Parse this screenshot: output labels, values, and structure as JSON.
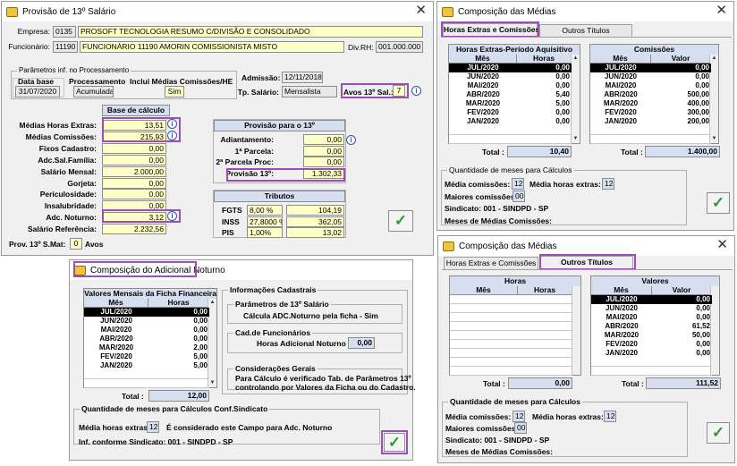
{
  "win1": {
    "title": "Provisão de 13º Salário",
    "empresa_label": "Empresa:",
    "empresa_code": "0135",
    "empresa_name": "PROSOFT TECNOLOGIA RESUMO C/DIVISÃO E CONSOLIDADO",
    "funcionario_label": "Funcionário:",
    "funcionario_code": "11190",
    "funcionario_name": "FUNCIONÁRIO 11190 AMORIN COMISSIONISTA MISTO",
    "divrh_label": "Div.RH:",
    "divrh_value": "001.000.000",
    "params_group": "Parâmetros inf. no Processamento",
    "data_base_label": "Data base",
    "data_base_value": "31/07/2020",
    "processamento_label": "Processamento",
    "processamento_value": "Acumulada",
    "inclui_label": "Inclui Médias Comissões/HE",
    "inclui_value": "Sim",
    "admissao_label": "Admissão:",
    "admissao_value": "12/11/2018",
    "tp_salario_label": "Tp. Salário:",
    "tp_salario_value": "Mensalista",
    "avos_label": "Avos 13º Sal.:",
    "avos_value": "7",
    "base_calculo_title": "Base de cálculo",
    "base_rows": [
      {
        "label": "Médias Horas Extras:",
        "value": "13,51"
      },
      {
        "label": "Médias Comissões:",
        "value": "215,93"
      },
      {
        "label": "Fixos Cadastro:",
        "value": "0,00"
      },
      {
        "label": "Adc.Sal.Família:",
        "value": "0,00"
      },
      {
        "label": "Salário Mensal:",
        "value": "2.000,00"
      },
      {
        "label": "Gorjeta:",
        "value": "0,00"
      },
      {
        "label": "Periculosidade:",
        "value": "0,00"
      },
      {
        "label": "Insalubridade:",
        "value": "0,00"
      },
      {
        "label": "Adc. Noturno:",
        "value": "3,12"
      },
      {
        "label": "Salário Referência:",
        "value": "2.232,56"
      }
    ],
    "provisao_title": "Provisão para o 13º",
    "provisao_rows": [
      {
        "label": "Adiantamento:",
        "value": "0,00"
      },
      {
        "label": "1ª Parcela:",
        "value": "0,00"
      },
      {
        "label": "2ª Parcela Proc:",
        "value": "0,00"
      },
      {
        "label": "Provisão 13º:",
        "value": "1.302,33"
      }
    ],
    "tributos_title": "Tributos",
    "tributos_rows": [
      {
        "label": "FGTS",
        "pct": "8,00 %",
        "value": "104,19"
      },
      {
        "label": "INSS",
        "pct": "27,8000 %",
        "value": "362,05"
      },
      {
        "label": "PIS",
        "pct": "1,00%",
        "value": "13,02"
      }
    ],
    "prov_smat_label": "Prov. 13º S.Mat:",
    "prov_smat_value": "0",
    "avos2_label": "Avos"
  },
  "win2": {
    "title": "Composição das Médias",
    "tab1": "Horas Extras e Comissões",
    "tab2": "Outros Títulos",
    "he_title": "Horas Extras-Período Aquisitivo",
    "he_col1": "Mês",
    "he_col2": "Horas",
    "he_rows": [
      {
        "mes": "JUL/2020",
        "val": "0,00"
      },
      {
        "mes": "JUN/2020",
        "val": "0,00"
      },
      {
        "mes": "MAI/2020",
        "val": "0,00"
      },
      {
        "mes": "ABR/2020",
        "val": "5,40"
      },
      {
        "mes": "MAR/2020",
        "val": "5,00"
      },
      {
        "mes": "FEV/2020",
        "val": "0,00"
      },
      {
        "mes": "JAN/2020",
        "val": "0,00"
      }
    ],
    "he_total_label": "Total :",
    "he_total": "10,40",
    "com_title": "Comissões",
    "com_col1": "Mês",
    "com_col2": "Valor",
    "com_rows": [
      {
        "mes": "JUL/2020",
        "val": "0,00"
      },
      {
        "mes": "JUN/2020",
        "val": "0,00"
      },
      {
        "mes": "MAI/2020",
        "val": "0,00"
      },
      {
        "mes": "ABR/2020",
        "val": "500,00"
      },
      {
        "mes": "MAR/2020",
        "val": "400,00"
      },
      {
        "mes": "FEV/2020",
        "val": "300,00"
      },
      {
        "mes": "JAN/2020",
        "val": "200,00"
      }
    ],
    "com_total_label": "Total :",
    "com_total": "1.400,00",
    "qtd_group": "Quantidade de meses para Cálculos",
    "media_com_label": "Média comissões:",
    "media_com_value": "12",
    "media_he_label": "Média horas extras:",
    "media_he_value": "12",
    "maiores_label": "Maiores comissões:",
    "maiores_value": "00",
    "sindicato": "Sindicato: 001 - SINDPD - SP",
    "meses_medias": "Meses de Médias Comissões:"
  },
  "win3": {
    "title": "Composição do Adicional Noturno",
    "vm_title": "Valores Mensais da Ficha Financeira",
    "vm_col1": "Mês",
    "vm_col2": "Horas",
    "vm_rows": [
      {
        "mes": "JUL/2020",
        "val": "0,00"
      },
      {
        "mes": "JUN/2020",
        "val": "0,00"
      },
      {
        "mes": "MAI/2020",
        "val": "0,00"
      },
      {
        "mes": "ABR/2020",
        "val": "0,00"
      },
      {
        "mes": "MAR/2020",
        "val": "2,00"
      },
      {
        "mes": "FEV/2020",
        "val": "5,00"
      },
      {
        "mes": "JAN/2020",
        "val": "5,00"
      }
    ],
    "vm_total_label": "Total :",
    "vm_total": "12,00",
    "info_cad_group": "Informações Cadastrais",
    "param13_group": "Parâmetros de 13º Salário",
    "calc_adc": "Cálcula ADC.Noturno pela ficha - Sim",
    "cadfunc_group": "Cad.de Funcionários",
    "horas_adc_label": "Horas Adicional Noturno",
    "horas_adc_value": "0,00",
    "consid_group": "Considerações Gerais",
    "consid_line1": "Para Cálculo é verificado Tab. de Parâmetros 13º",
    "consid_line2": "controlando por Valores da Ficha ou do Cadastro.",
    "qtd_group": "Quantidade de meses para Cálculos Conf.Sindicato",
    "media_he_label": "Média horas extras",
    "media_he_value": "12",
    "considerado": "É considerado este Campo para Adc. Noturno",
    "inf_sindicato": "Inf. conforme Sindicato: 001 - SINDPD - SP"
  },
  "win4": {
    "title": "Composição das Médias",
    "tab1": "Horas Extras e Comissões",
    "tab2": "Outros Títulos",
    "horas_title": "Horas",
    "horas_col1": "Mês",
    "horas_col2": "Horas",
    "horas_total_label": "Total :",
    "horas_total": "0,00",
    "val_title": "Valores",
    "val_col1": "Mês",
    "val_col2": "Valor",
    "val_rows": [
      {
        "mes": "JUL/2020",
        "val": "0,00"
      },
      {
        "mes": "JUN/2020",
        "val": "0,00"
      },
      {
        "mes": "MAI/2020",
        "val": "0,00"
      },
      {
        "mes": "ABR/2020",
        "val": "61,52"
      },
      {
        "mes": "MAR/2020",
        "val": "50,00"
      },
      {
        "mes": "FEV/2020",
        "val": "0,00"
      },
      {
        "mes": "JAN/2020",
        "val": "0,00"
      }
    ],
    "val_total_label": "Total :",
    "val_total": "111,52",
    "qtd_group": "Quantidade de meses para Cálculos",
    "media_com_label": "Média comissões:",
    "media_com_value": "12",
    "media_he_label": "Média horas extras:",
    "media_he_value": "12",
    "maiores_label": "Maiores comissões:",
    "maiores_value": "00",
    "sindicato": "Sindicato: 001 - SINDPD - SP",
    "meses_medias": "Meses de Médias Comissões:"
  },
  "colors": {
    "field_bg": "#ffffc8",
    "header_bg": "#d6dff0",
    "highlight": "#9b4fb2",
    "ok_green": "#2d9a2d"
  },
  "icons": {
    "info": "info-icon",
    "ok": "checkmark-icon",
    "close": "close-icon",
    "app": "app-icon"
  }
}
